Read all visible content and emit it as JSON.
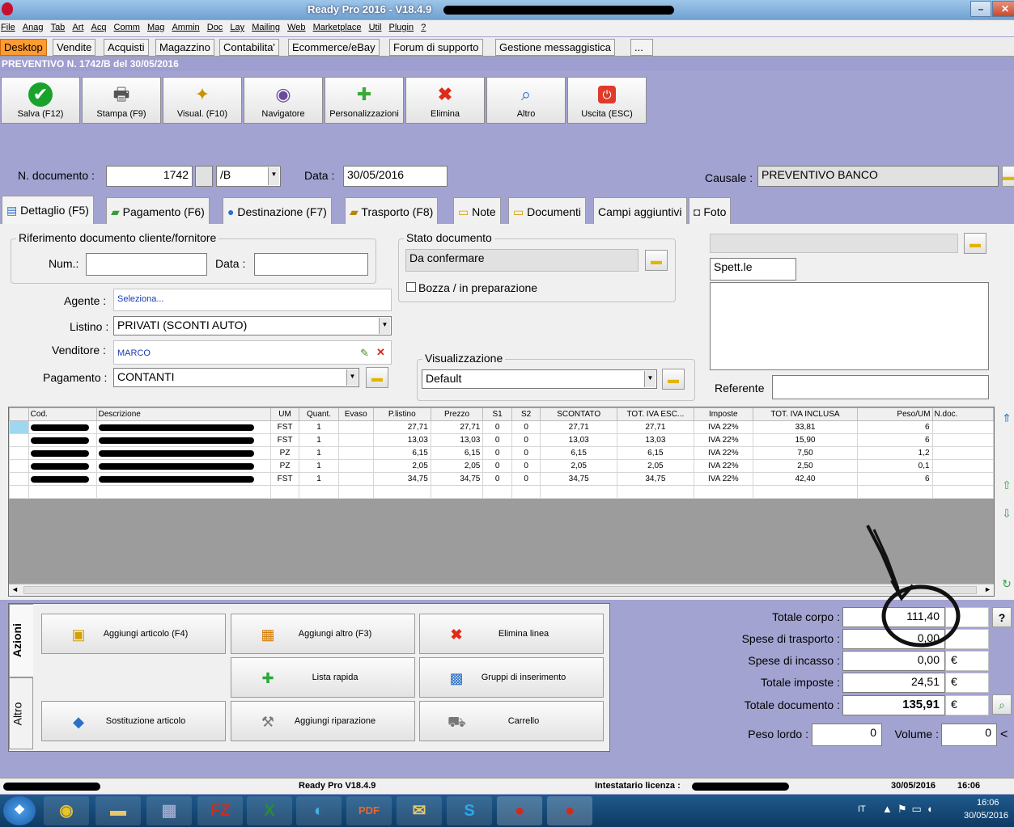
{
  "window": {
    "title": "Ready Pro 2016 - V18.4.9"
  },
  "menu": [
    "File",
    "Anag",
    "Tab",
    "Art",
    "Acq",
    "Comm",
    "Mag",
    "Ammin",
    "Doc",
    "Lay",
    "Mailing",
    "Web",
    "Marketplace",
    "Util",
    "Plugin",
    "?"
  ],
  "app_tabs": [
    "Desktop",
    "Vendite",
    "Acquisti",
    "Magazzino",
    "Contabilita'",
    "Ecommerce/eBay",
    "Forum di supporto",
    "Gestione messaggistica",
    "..."
  ],
  "doc_header": "PREVENTIVO N. 1742/B del 30/05/2016",
  "toolbar": [
    {
      "label": "Salva (F12)",
      "icon": "check-icon",
      "color": "#1aa32c"
    },
    {
      "label": "Stampa (F9)",
      "icon": "printer-icon",
      "color": "#666"
    },
    {
      "label": "Visual. (F10)",
      "icon": "magic-wand-icon",
      "color": "#c89500"
    },
    {
      "label": "Navigatore",
      "icon": "navigator-icon",
      "color": "#6a4a9c"
    },
    {
      "label": "Personalizzazioni",
      "icon": "puzzle-icon",
      "color": "#3aa83a"
    },
    {
      "label": "Elimina",
      "icon": "delete-x-icon",
      "color": "#e02a1a"
    },
    {
      "label": "Altro",
      "icon": "magnifier-icon",
      "color": "#2a70c8"
    },
    {
      "label": "Uscita (ESC)",
      "icon": "power-icon",
      "color": "#e03a2a"
    }
  ],
  "doc": {
    "num_label": "N. documento :",
    "num": "1742",
    "series": "/B",
    "date_label": "Data :",
    "date": "30/05/2016",
    "causale_label": "Causale :",
    "causale": "PREVENTIVO BANCO"
  },
  "form_tabs": [
    "Dettaglio (F5)",
    "Pagamento (F6)",
    "Destinazione (F7)",
    "Trasporto (F8)",
    "Note",
    "Documenti",
    "Campi aggiuntivi",
    "Foto"
  ],
  "riferimento": {
    "title": "Riferimento documento cliente/fornitore",
    "num_label": "Num.:",
    "num": "",
    "data_label": "Data :",
    "data": ""
  },
  "stato": {
    "title": "Stato documento",
    "value": "Da confermare",
    "bozza": "Bozza / in preparazione"
  },
  "cliente": {
    "spett": "Spett.le",
    "referente_label": "Referente",
    "referente": ""
  },
  "agente": {
    "label": "Agente :",
    "value": "Seleziona..."
  },
  "listino": {
    "label": "Listino :",
    "value": "PRIVATI (SCONTI AUTO)"
  },
  "venditore": {
    "label": "Venditore :",
    "value": "MARCO"
  },
  "pagamento": {
    "label": "Pagamento :",
    "value": "CONTANTI"
  },
  "visualizzazione": {
    "title": "Visualizzazione",
    "value": "Default"
  },
  "grid": {
    "columns": [
      "Cod.",
      "Descrizione",
      "UM",
      "Quant.",
      "Evaso",
      "P.listino",
      "Prezzo",
      "S1",
      "S2",
      "SCONTATO",
      "TOT. IVA ESC...",
      "Imposte",
      "TOT. IVA INCLUSA",
      "Peso/UM",
      "N.doc."
    ],
    "rows": [
      [
        "",
        "",
        "FST",
        "1",
        "",
        "27,71",
        "27,71",
        "0",
        "0",
        "27,71",
        "27,71",
        "IVA 22%",
        "33,81",
        "6",
        ""
      ],
      [
        "",
        "",
        "FST",
        "1",
        "",
        "13,03",
        "13,03",
        "0",
        "0",
        "13,03",
        "13,03",
        "IVA 22%",
        "15,90",
        "6",
        ""
      ],
      [
        "",
        "",
        "PZ",
        "1",
        "",
        "6,15",
        "6,15",
        "0",
        "0",
        "6,15",
        "6,15",
        "IVA 22%",
        "7,50",
        "1,2",
        ""
      ],
      [
        "",
        "",
        "PZ",
        "1",
        "",
        "2,05",
        "2,05",
        "0",
        "0",
        "2,05",
        "2,05",
        "IVA 22%",
        "2,50",
        "0,1",
        ""
      ],
      [
        "",
        "",
        "FST",
        "1",
        "",
        "34,75",
        "34,75",
        "0",
        "0",
        "34,75",
        "34,75",
        "IVA 22%",
        "42,40",
        "6",
        ""
      ]
    ]
  },
  "actions": {
    "tab_azioni": "Azioni",
    "tab_altro": "Altro",
    "buttons": [
      "Aggiungi articolo (F4)",
      "Aggiungi altro (F3)",
      "Elimina linea",
      "Lista rapida",
      "Gruppi di inserimento",
      "Sostituzione articolo",
      "Aggiungi riparazione",
      "Carrello"
    ]
  },
  "totals": {
    "corpo_label": "Totale corpo :",
    "corpo": "111,40",
    "trasporto_label": "Spese di trasporto :",
    "trasporto": "0,00",
    "incasso_label": "Spese di incasso :",
    "incasso": "0,00",
    "imposte_label": "Totale imposte :",
    "imposte": "24,51",
    "documento_label": "Totale documento :",
    "documento": "135,91",
    "currency": "€",
    "peso_label": "Peso lordo :",
    "peso": "0",
    "volume_label": "Volume :",
    "volume": "0"
  },
  "status": {
    "version": "Ready Pro V18.4.9",
    "license_label": "Intestatario licenza :",
    "date": "30/05/2016",
    "time": "16:06"
  },
  "taskbar": {
    "lang": "IT",
    "time": "16:06",
    "date": "30/05/2016"
  }
}
